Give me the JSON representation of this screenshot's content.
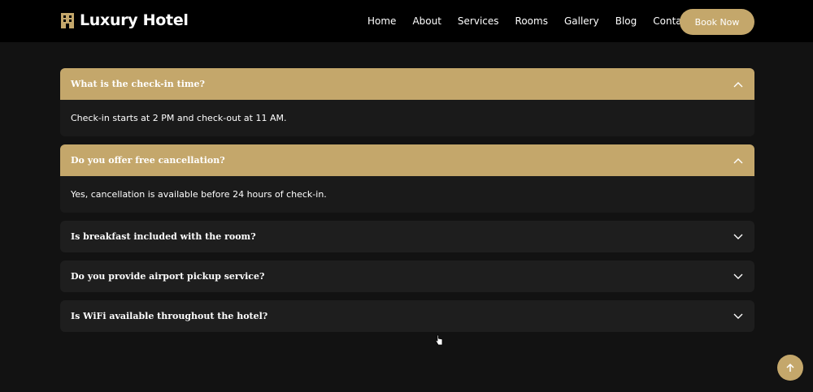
{
  "brand": {
    "name": "Luxury Hotel",
    "icon": "hotel-building-icon"
  },
  "nav": {
    "links": [
      "Home",
      "About",
      "Services",
      "Rooms",
      "Gallery",
      "Blog",
      "Contact"
    ],
    "cta_label": "Book Now"
  },
  "faq": [
    {
      "question": "What is the check-in time?",
      "answer": "Check-in starts at 2 PM and check-out at 11 AM.",
      "open": true
    },
    {
      "question": "Do you offer free cancellation?",
      "answer": "Yes, cancellation is available before 24 hours of check-in.",
      "open": true
    },
    {
      "question": "Is breakfast included with the room?",
      "open": false
    },
    {
      "question": "Do you provide airport pickup service?",
      "open": false
    },
    {
      "question": "Is WiFi available throughout the hotel?",
      "open": false
    }
  ],
  "colors": {
    "accent": "#c4a76b",
    "background": "#121212",
    "card": "#1e1e1e",
    "navbar": "#000000"
  },
  "icons": {
    "expanded": "chevron-up-icon",
    "collapsed": "chevron-down-icon",
    "back_to_top": "arrow-up-icon"
  }
}
